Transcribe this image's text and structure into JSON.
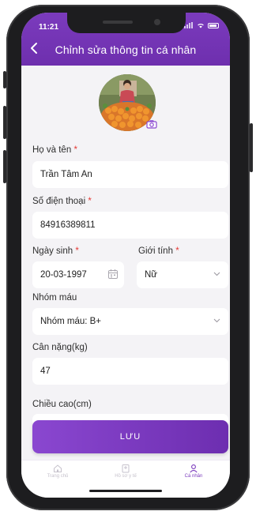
{
  "status_bar": {
    "time": "11:21"
  },
  "header": {
    "title": "Chỉnh sửa thông tin cá nhân"
  },
  "form": {
    "full_name": {
      "label": "Họ và tên",
      "required": "*",
      "value": "Trần Tâm An"
    },
    "phone": {
      "label": "Số điện thoại",
      "required": "*",
      "value": "84916389811"
    },
    "birthday": {
      "label": "Ngày sinh",
      "required": "*",
      "value": "20-03-1997"
    },
    "gender": {
      "label": "Giới tính",
      "required": "*",
      "value": "Nữ"
    },
    "blood_type": {
      "label": "Nhóm máu",
      "value": "Nhóm máu: B+"
    },
    "weight": {
      "label": "Cân nặng(kg)",
      "value": "47"
    },
    "height": {
      "label": "Chiều cao(cm)",
      "value": ""
    }
  },
  "save_button": {
    "label": "LƯU"
  },
  "tabs": [
    {
      "label": "Trang chủ",
      "icon": "home-icon",
      "active": false
    },
    {
      "label": "Hồ sơ y tế",
      "icon": "medical-record-icon",
      "active": false
    },
    {
      "label": "Cá nhân",
      "icon": "person-icon",
      "active": true
    }
  ],
  "colors": {
    "primary": "#7b3bbd",
    "required": "#e53935",
    "inactive_tab": "#b9b5bf"
  },
  "icons": [
    "back-arrow-icon",
    "camera-icon",
    "calendar-icon",
    "chevron-down-icon"
  ]
}
